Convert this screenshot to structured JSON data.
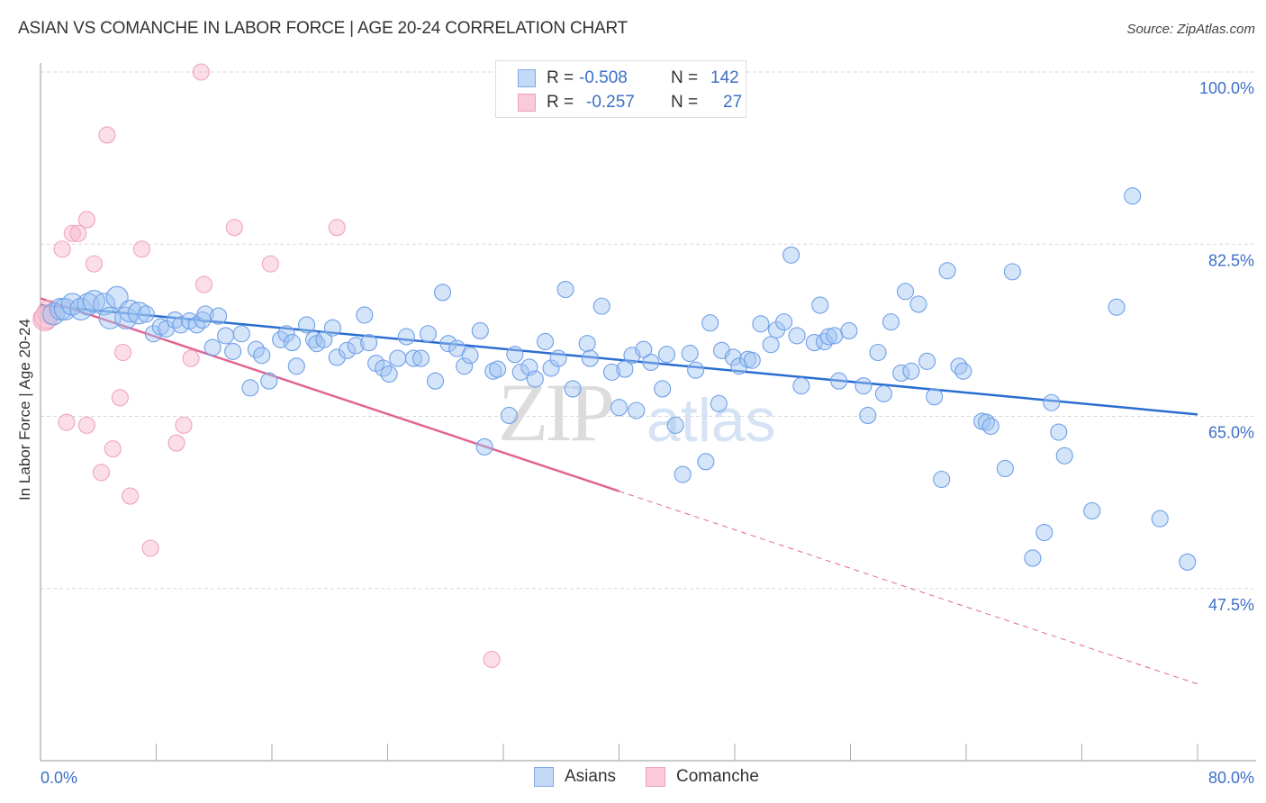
{
  "header": {
    "title": "ASIAN VS COMANCHE IN LABOR FORCE | AGE 20-24 CORRELATION CHART",
    "source": "Source: ZipAtlas.com"
  },
  "watermark": {
    "zip": "ZIP",
    "atlas": "atlas"
  },
  "legend": {
    "rows": [
      {
        "name": "Asians",
        "r_label": "R =",
        "r_value": "-0.508",
        "n_label": "N =",
        "n_value": "142"
      },
      {
        "name": "Comanche",
        "r_label": "R =",
        "r_value": "-0.257",
        "n_label": "N =",
        "n_value": "27"
      }
    ]
  },
  "chart_data": {
    "type": "scatter",
    "title": "ASIAN VS COMANCHE IN LABOR FORCE | AGE 20-24 CORRELATION CHART",
    "xlabel": "",
    "ylabel": "In Labor Force | Age 20-24",
    "xlim": [
      0,
      80
    ],
    "ylim": [
      30,
      101
    ],
    "x_tick_labels": [
      "0.0%",
      "80.0%"
    ],
    "x_ticks": [
      0,
      8,
      16,
      24,
      32,
      40,
      48,
      56,
      64,
      72,
      80
    ],
    "y_ticks": [
      100,
      82.5,
      65,
      47.5
    ],
    "y_tick_labels": [
      "100.0%",
      "82.5%",
      "65.0%",
      "47.5%"
    ],
    "grid": true,
    "legend_position": "top-center",
    "colors": {
      "Asians": "#6fa0e8",
      "Comanche": "#f0a3bd",
      "asians_line": "#2a6dd1",
      "comanche_line": "#e26591"
    },
    "series": [
      {
        "name": "Asians",
        "r": -0.508,
        "n": 142,
        "trend": {
          "x0": 0,
          "y0": 76.3,
          "x1": 80,
          "y1": 65.2,
          "dashed_from": null
        },
        "points": [
          [
            0.9,
            75.4
          ],
          [
            1.4,
            75.9
          ],
          [
            1.7,
            75.9
          ],
          [
            2.2,
            76.4
          ],
          [
            2.8,
            75.9
          ],
          [
            3.3,
            76.4
          ],
          [
            3.7,
            76.7
          ],
          [
            4.4,
            76.4
          ],
          [
            4.8,
            75.0
          ],
          [
            5.3,
            77.1
          ],
          [
            5.9,
            75.0
          ],
          [
            6.2,
            75.7
          ],
          [
            6.8,
            75.5
          ],
          [
            7.3,
            75.4
          ],
          [
            7.8,
            73.4
          ],
          [
            8.3,
            74.1
          ],
          [
            8.7,
            73.9
          ],
          [
            9.3,
            74.8
          ],
          [
            9.7,
            74.3
          ],
          [
            10.3,
            74.7
          ],
          [
            10.8,
            74.3
          ],
          [
            11.2,
            74.8
          ],
          [
            11.4,
            75.4
          ],
          [
            12.3,
            75.2
          ],
          [
            11.9,
            72.0
          ],
          [
            12.8,
            73.2
          ],
          [
            13.3,
            71.6
          ],
          [
            13.9,
            73.4
          ],
          [
            14.5,
            67.9
          ],
          [
            14.9,
            71.8
          ],
          [
            15.3,
            71.2
          ],
          [
            15.8,
            68.6
          ],
          [
            16.6,
            72.8
          ],
          [
            17.0,
            73.4
          ],
          [
            17.4,
            72.5
          ],
          [
            17.7,
            70.1
          ],
          [
            18.4,
            74.3
          ],
          [
            18.9,
            72.8
          ],
          [
            19.1,
            72.4
          ],
          [
            19.6,
            72.8
          ],
          [
            20.2,
            74.0
          ],
          [
            20.5,
            71.0
          ],
          [
            21.2,
            71.7
          ],
          [
            21.8,
            72.2
          ],
          [
            22.4,
            75.3
          ],
          [
            22.7,
            72.5
          ],
          [
            23.2,
            70.4
          ],
          [
            23.7,
            69.9
          ],
          [
            24.1,
            69.3
          ],
          [
            24.7,
            70.9
          ],
          [
            25.3,
            73.1
          ],
          [
            25.8,
            70.9
          ],
          [
            26.3,
            70.9
          ],
          [
            26.8,
            73.4
          ],
          [
            27.3,
            68.6
          ],
          [
            27.8,
            77.6
          ],
          [
            28.2,
            72.4
          ],
          [
            28.8,
            71.9
          ],
          [
            29.3,
            70.1
          ],
          [
            29.7,
            71.2
          ],
          [
            30.4,
            73.7
          ],
          [
            30.7,
            61.9
          ],
          [
            31.3,
            69.6
          ],
          [
            31.6,
            69.8
          ],
          [
            32.4,
            65.1
          ],
          [
            32.8,
            71.3
          ],
          [
            33.2,
            69.5
          ],
          [
            33.8,
            70.0
          ],
          [
            34.2,
            68.8
          ],
          [
            34.9,
            72.6
          ],
          [
            35.3,
            69.9
          ],
          [
            35.8,
            70.9
          ],
          [
            36.3,
            77.9
          ],
          [
            36.8,
            67.8
          ],
          [
            37.8,
            72.4
          ],
          [
            38.0,
            70.9
          ],
          [
            38.8,
            76.2
          ],
          [
            39.5,
            69.5
          ],
          [
            40.0,
            65.9
          ],
          [
            40.4,
            69.8
          ],
          [
            40.9,
            71.2
          ],
          [
            41.2,
            65.6
          ],
          [
            41.7,
            71.8
          ],
          [
            42.2,
            70.5
          ],
          [
            43.0,
            67.8
          ],
          [
            43.3,
            71.3
          ],
          [
            43.9,
            64.1
          ],
          [
            44.4,
            59.1
          ],
          [
            44.9,
            71.4
          ],
          [
            45.3,
            69.7
          ],
          [
            46.0,
            60.4
          ],
          [
            46.3,
            74.5
          ],
          [
            46.9,
            66.3
          ],
          [
            47.1,
            71.7
          ],
          [
            47.9,
            71.0
          ],
          [
            48.3,
            70.1
          ],
          [
            48.9,
            70.8
          ],
          [
            49.2,
            70.7
          ],
          [
            49.8,
            74.4
          ],
          [
            50.5,
            72.3
          ],
          [
            50.9,
            73.8
          ],
          [
            51.4,
            74.6
          ],
          [
            51.9,
            81.4
          ],
          [
            52.3,
            73.2
          ],
          [
            52.6,
            68.1
          ],
          [
            53.5,
            72.5
          ],
          [
            53.9,
            76.3
          ],
          [
            54.2,
            72.6
          ],
          [
            54.5,
            73.1
          ],
          [
            54.9,
            73.2
          ],
          [
            55.2,
            68.6
          ],
          [
            55.9,
            73.7
          ],
          [
            56.9,
            68.1
          ],
          [
            57.2,
            65.1
          ],
          [
            57.9,
            71.5
          ],
          [
            58.3,
            67.3
          ],
          [
            58.8,
            74.6
          ],
          [
            59.5,
            69.4
          ],
          [
            59.8,
            77.7
          ],
          [
            60.2,
            69.6
          ],
          [
            60.7,
            76.4
          ],
          [
            61.3,
            70.6
          ],
          [
            61.8,
            67.0
          ],
          [
            62.3,
            58.6
          ],
          [
            62.7,
            79.8
          ],
          [
            63.5,
            70.1
          ],
          [
            63.8,
            69.6
          ],
          [
            65.1,
            64.5
          ],
          [
            65.4,
            64.4
          ],
          [
            65.7,
            64.0
          ],
          [
            66.7,
            59.7
          ],
          [
            67.2,
            79.7
          ],
          [
            68.6,
            50.6
          ],
          [
            69.4,
            53.2
          ],
          [
            69.9,
            66.4
          ],
          [
            70.4,
            63.4
          ],
          [
            70.8,
            61.0
          ],
          [
            72.7,
            55.4
          ],
          [
            74.4,
            76.1
          ],
          [
            75.5,
            87.4
          ],
          [
            77.4,
            54.6
          ],
          [
            79.3,
            50.2
          ]
        ]
      },
      {
        "name": "Comanche",
        "r": -0.257,
        "n": 27,
        "trend": {
          "x0": 0,
          "y0": 77.0,
          "x1": 80,
          "y1": 37.8,
          "solid_until_x": 40
        },
        "points": [
          [
            0.3,
            74.9
          ],
          [
            0.6,
            75.6
          ],
          [
            1.5,
            82.0
          ],
          [
            1.8,
            64.4
          ],
          [
            2.2,
            83.6
          ],
          [
            2.6,
            83.6
          ],
          [
            3.2,
            85.0
          ],
          [
            3.2,
            64.1
          ],
          [
            3.7,
            80.5
          ],
          [
            4.2,
            59.3
          ],
          [
            4.6,
            93.6
          ],
          [
            5.0,
            61.7
          ],
          [
            5.5,
            66.9
          ],
          [
            5.7,
            71.5
          ],
          [
            6.2,
            56.9
          ],
          [
            7.0,
            82.0
          ],
          [
            7.6,
            51.6
          ],
          [
            9.4,
            62.3
          ],
          [
            9.9,
            64.1
          ],
          [
            10.4,
            70.9
          ],
          [
            11.3,
            78.4
          ],
          [
            11.1,
            100.0
          ],
          [
            13.4,
            84.2
          ],
          [
            15.9,
            80.5
          ],
          [
            20.5,
            84.2
          ],
          [
            31.2,
            40.3
          ],
          [
            0.4,
            75.1
          ]
        ]
      }
    ]
  }
}
